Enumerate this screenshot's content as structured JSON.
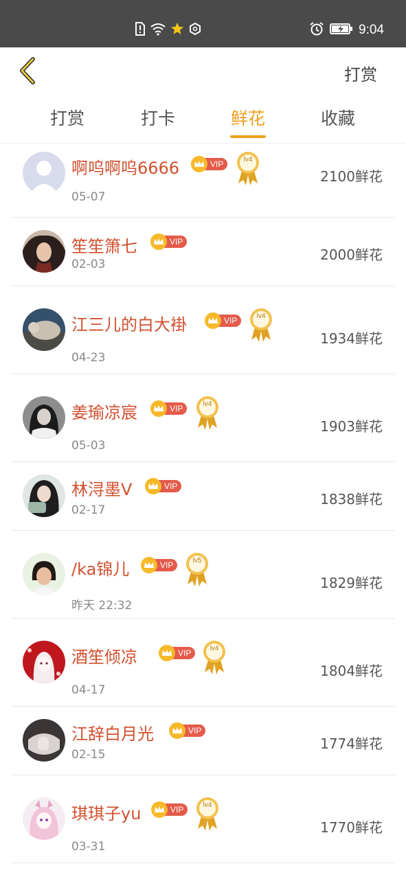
{
  "status_bar": {
    "time": "9:04",
    "icons": [
      "sim-alert-icon",
      "wifi-icon",
      "star-badge-icon",
      "hexagon-icon",
      "alarm-icon",
      "battery-charging-icon"
    ]
  },
  "header": {
    "back_icon": "chevron-left-icon",
    "action_label": "打赏"
  },
  "tabs": [
    {
      "label": "打赏",
      "active": false
    },
    {
      "label": "打卡",
      "active": false
    },
    {
      "label": "鲜花",
      "active": true
    },
    {
      "label": "收藏",
      "active": false
    }
  ],
  "colors": {
    "accent": "#f0a020",
    "name": "#d2502f",
    "vip_tag": "#e45b4a",
    "crown": "#f7b92b",
    "status_bar": "#4a4a4a"
  },
  "vip_label": "VIP",
  "rows": [
    {
      "name": "啊呜啊呜6666",
      "date": "05-07",
      "amount": "2100鲜花",
      "vip": true,
      "medal": "lv4"
    },
    {
      "name": "笙笙箫七",
      "date": "02-03",
      "amount": "2000鲜花",
      "vip": true,
      "medal": ""
    },
    {
      "name": "江三儿的白大褂",
      "date": "04-23",
      "amount": "1934鲜花",
      "vip": true,
      "medal": "lv4"
    },
    {
      "name": "姜瑜凉宸",
      "date": "05-03",
      "amount": "1903鲜花",
      "vip": true,
      "medal": "lv4"
    },
    {
      "name": "林浔墨V",
      "date": "02-17",
      "amount": "1838鲜花",
      "vip": true,
      "medal": ""
    },
    {
      "name": "/ka锦儿",
      "date": "昨天 22:32",
      "amount": "1829鲜花",
      "vip": true,
      "medal": "lv5"
    },
    {
      "name": "酒笙倾凉",
      "date": "04-17",
      "amount": "1804鲜花",
      "vip": true,
      "medal": "lv4"
    },
    {
      "name": "江辞白月光",
      "date": "02-15",
      "amount": "1774鲜花",
      "vip": true,
      "medal": ""
    },
    {
      "name": "琪琪子yu",
      "date": "03-31",
      "amount": "1770鲜花",
      "vip": true,
      "medal": "lv4"
    }
  ]
}
